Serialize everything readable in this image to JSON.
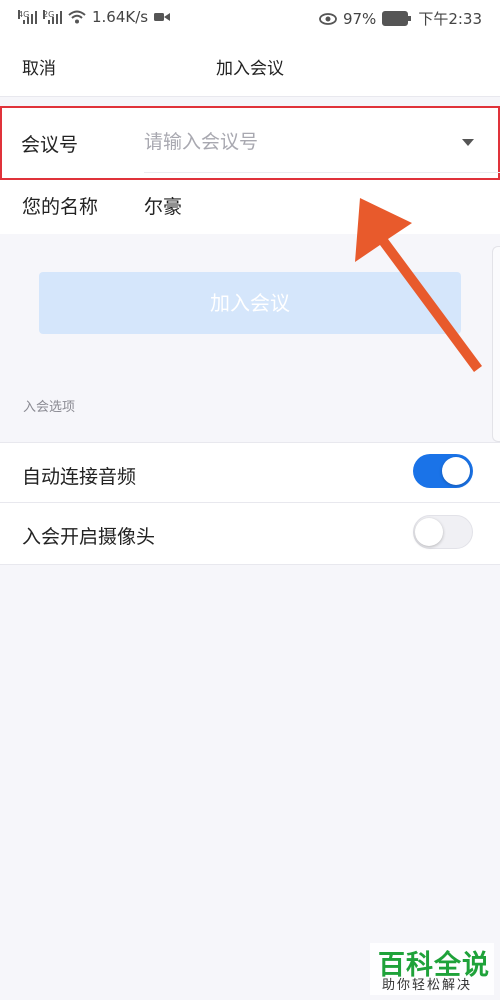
{
  "status_bar": {
    "net1": "4G",
    "net2": "2G",
    "speed": "1.64K/s",
    "battery": "97%",
    "time": "下午2:33"
  },
  "header": {
    "cancel_label": "取消",
    "title": "加入会议"
  },
  "form": {
    "meeting_label": "会议号",
    "meeting_placeholder": "请输入会议号",
    "meeting_value": "",
    "name_label": "您的名称",
    "name_value": "尔豪"
  },
  "join_button_label": "加入会议",
  "options": {
    "section_label": "入会选项",
    "auto_audio_label": "自动连接音频",
    "auto_audio_on": true,
    "camera_label": "入会开启摄像头",
    "camera_on": false
  },
  "colors": {
    "highlight_border": "#e0323a",
    "annotation_arrow": "#e85a2c",
    "toggle_on": "#1a73e8",
    "join_button_bg": "#d5e6fb"
  },
  "watermark": {
    "title": "百科全说",
    "subtitle": "助你轻松解决"
  }
}
